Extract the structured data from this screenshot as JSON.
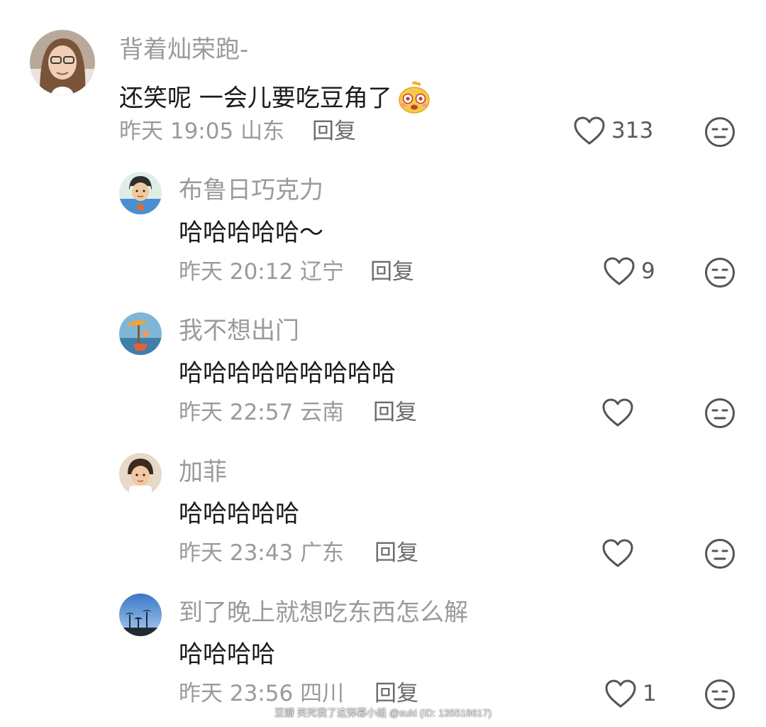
{
  "comments": [
    {
      "username": "背着灿荣跑-",
      "content": "还笑呢 一会儿要吃豆角了",
      "emoji": "dizzy-face-emoji",
      "date": "昨天",
      "time": "19:05",
      "location": "山东",
      "reply_label": "回复",
      "like_count": "313"
    },
    {
      "username": "布鲁日巧克力",
      "content": "哈哈哈哈哈～",
      "date": "昨天",
      "time": "20:12",
      "location": "辽宁",
      "reply_label": "回复",
      "like_count": "9"
    },
    {
      "username": "我不想出门",
      "content": "哈哈哈哈哈哈哈哈哈",
      "date": "昨天",
      "time": "22:57",
      "location": "云南",
      "reply_label": "回复",
      "like_count": ""
    },
    {
      "username": "加菲",
      "content": "哈哈哈哈哈",
      "date": "昨天",
      "time": "23:43",
      "location": "广东",
      "reply_label": "回复",
      "like_count": ""
    },
    {
      "username": "到了晚上就想吃东西怎么解",
      "content": "哈哈哈哈",
      "date": "昨天",
      "time": "23:56",
      "location": "四川",
      "reply_label": "回复",
      "like_count": "1"
    }
  ],
  "watermark": "豆瓣  笑死我了这弹幕小组 @suki (ID: 135518617)",
  "icons": {
    "like": "heart-outline-icon",
    "dislike": "neutral-face-icon"
  },
  "colors": {
    "username": "#9a9a9a",
    "content": "#1a1a1a",
    "meta": "#9a9a9a",
    "reply": "#6b6b6b",
    "icon": "#555555"
  }
}
